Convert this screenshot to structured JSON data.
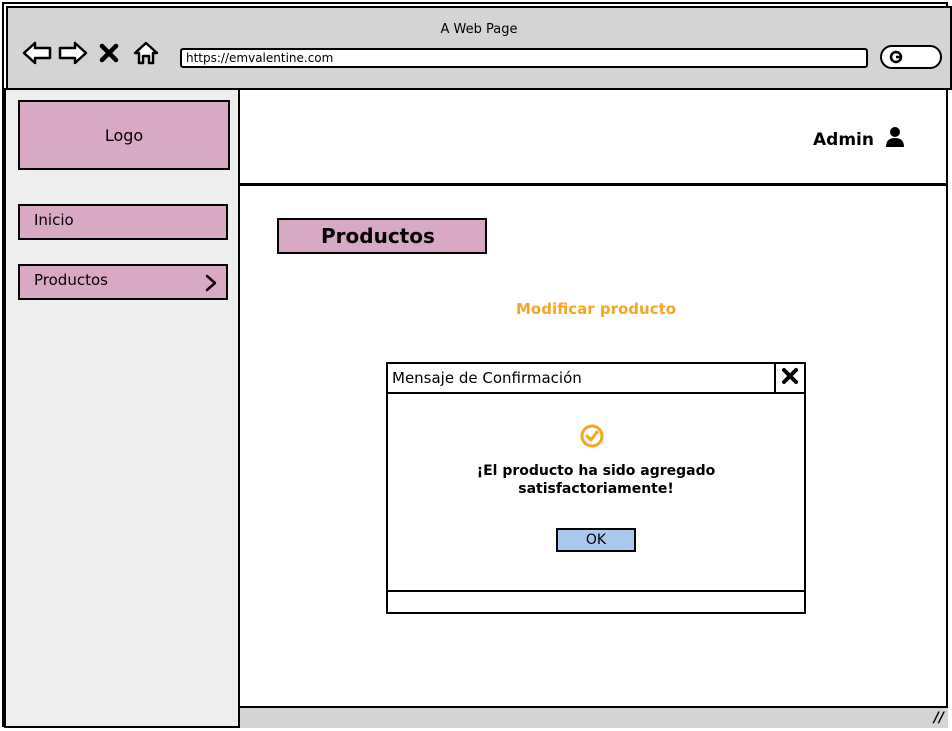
{
  "browser": {
    "window_title": "A Web Page",
    "url": "https://emvalentine.com",
    "icons": [
      "back-arrow-icon",
      "forward-arrow-icon",
      "close-x-icon",
      "home-icon",
      "search-icon"
    ]
  },
  "sidebar": {
    "logo": "Logo",
    "items": [
      {
        "label": "Inicio"
      },
      {
        "label": "Productos",
        "icon": "chevron-right-icon"
      }
    ]
  },
  "header": {
    "user_label": "Admin",
    "user_icon": "user-icon"
  },
  "main": {
    "page_title": "Productos",
    "subtitle": "Modificar producto",
    "subtitle_color": "#f5a623"
  },
  "dialog": {
    "title": "Mensaje de Confirmación",
    "message_line1": "¡El producto ha sido agregado",
    "message_line2": "satisfactoriamente!",
    "ok_label": "OK",
    "icon": "check-circle-icon"
  },
  "colors": {
    "accent_pink": "#d8a8c4",
    "button_blue": "#a8c8f0",
    "chrome_gray": "#d4d4d4",
    "sidebar_gray": "#eeeeee"
  }
}
